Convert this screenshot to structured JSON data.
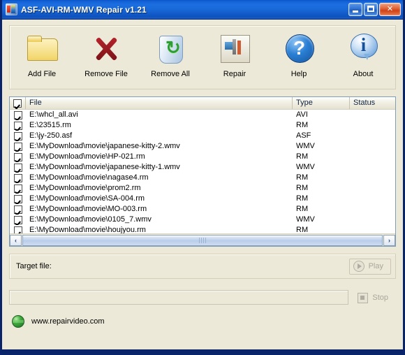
{
  "window": {
    "title": "ASF-AVI-RM-WMV Repair v1.21",
    "app_icon": "app-icon",
    "buttons": {
      "minimize": "minimize-button",
      "maximize": "maximize-button",
      "close": "close-button"
    },
    "colors": {
      "titlebar_blue": "#1868D8",
      "window_border": "#0A246A",
      "face": "#ECE9D8",
      "close_red": "#CF4216"
    }
  },
  "toolbar": {
    "items": [
      {
        "label": "Add File",
        "icon": "folder-icon"
      },
      {
        "label": "Remove File",
        "icon": "red-x-icon"
      },
      {
        "label": "Remove All",
        "icon": "recycle-bin-icon"
      },
      {
        "label": "Repair",
        "icon": "tools-icon"
      },
      {
        "label": "Help",
        "icon": "question-mark-icon"
      },
      {
        "label": "About",
        "icon": "info-icon"
      }
    ]
  },
  "file_list": {
    "columns": [
      "File",
      "Type",
      "Status"
    ],
    "header_checkbox_checked": true,
    "rows": [
      {
        "checked": true,
        "file": "E:\\whcl_all.avi",
        "type": "AVI",
        "status": ""
      },
      {
        "checked": true,
        "file": "E:\\23515.rm",
        "type": "RM",
        "status": ""
      },
      {
        "checked": true,
        "file": "E:\\jy-250.asf",
        "type": "ASF",
        "status": ""
      },
      {
        "checked": true,
        "file": "E:\\MyDownload\\movie\\japanese-kitty-2.wmv",
        "type": "WMV",
        "status": ""
      },
      {
        "checked": true,
        "file": "E:\\MyDownload\\movie\\HP-021.rm",
        "type": "RM",
        "status": ""
      },
      {
        "checked": true,
        "file": "E:\\MyDownload\\movie\\japanese-kitty-1.wmv",
        "type": "WMV",
        "status": ""
      },
      {
        "checked": true,
        "file": "E:\\MyDownload\\movie\\nagase4.rm",
        "type": "RM",
        "status": ""
      },
      {
        "checked": true,
        "file": "E:\\MyDownload\\movie\\prom2.rm",
        "type": "RM",
        "status": ""
      },
      {
        "checked": true,
        "file": "E:\\MyDownload\\movie\\SA-004.rm",
        "type": "RM",
        "status": ""
      },
      {
        "checked": true,
        "file": "E:\\MyDownload\\movie\\MO-003.rm",
        "type": "RM",
        "status": ""
      },
      {
        "checked": true,
        "file": "E:\\MyDownload\\movie\\0105_7.wmv",
        "type": "WMV",
        "status": ""
      },
      {
        "checked": true,
        "file": "E:\\MyDownload\\movie\\houjyou.rm",
        "type": "RM",
        "status": ""
      }
    ],
    "scrollbar": {
      "left_arrow": "‹",
      "right_arrow": "›"
    }
  },
  "target": {
    "label": "Target file:",
    "value": "",
    "play_button": "Play",
    "play_enabled": false
  },
  "progress": {
    "value": "",
    "stop_button": "Stop",
    "stop_enabled": false
  },
  "footer": {
    "url": "www.repairvideo.com",
    "icon": "globe-icon"
  }
}
